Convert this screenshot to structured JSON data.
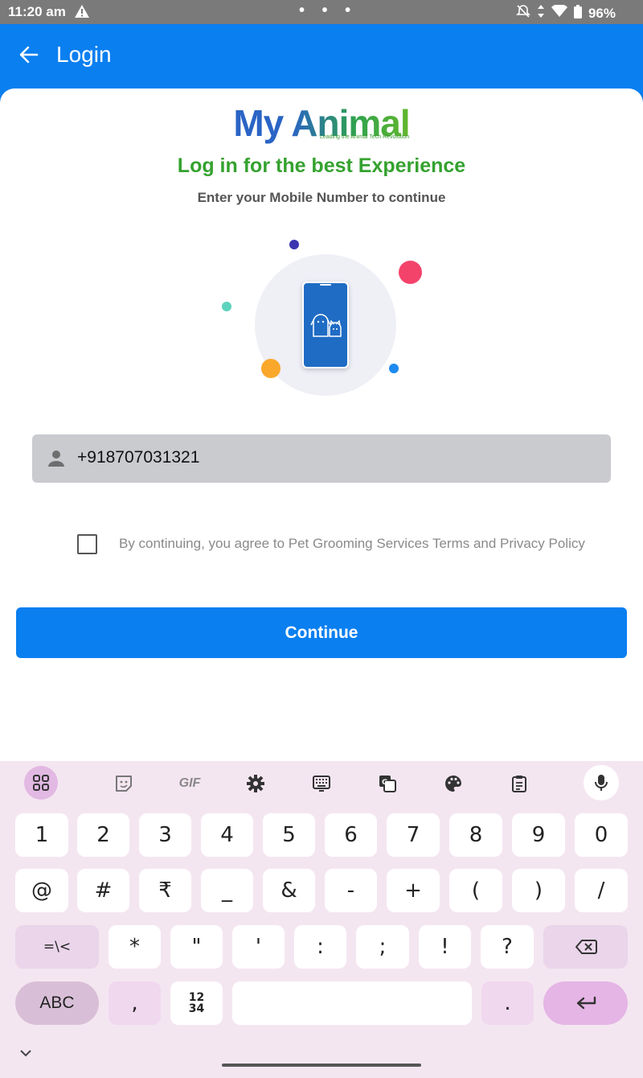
{
  "status_bar": {
    "time": "11:20 am",
    "battery": "96%",
    "dots": "• • •"
  },
  "app_bar": {
    "title": "Login"
  },
  "logo": {
    "word1": "My",
    "word2": "Animal",
    "tagline": "Leading the Animal Tech Revolution"
  },
  "headline": "Log in for the best Experience",
  "subline": "Enter your Mobile Number to continue",
  "phone_input": {
    "value": "+918707031321"
  },
  "consent": {
    "checked": false,
    "text": "By continuing, you agree to Pet Grooming Services Terms and Privacy Policy"
  },
  "continue_button": {
    "label": "Continue"
  },
  "colors": {
    "primary": "#0a7ff0",
    "headline_green": "#35a22f",
    "logo_blue": "#2a64c5",
    "dot_navy": "#3b35b0",
    "dot_red": "#f4436b",
    "dot_teal": "#5dd3bd",
    "dot_orange": "#f9a82c",
    "dot_blue": "#1e8af0"
  },
  "keyboard": {
    "toolbar_icons": [
      "apps-icon",
      "sticker-icon",
      "gif-icon",
      "settings-icon",
      "keyboard-icon",
      "translate-icon",
      "palette-icon",
      "clipboard-icon",
      "mic-icon"
    ],
    "gif_label": "GIF",
    "row1": [
      "1",
      "2",
      "3",
      "4",
      "5",
      "6",
      "7",
      "8",
      "9",
      "0"
    ],
    "row2": [
      "@",
      "#",
      "₹",
      "_",
      "&",
      "-",
      "+",
      "(",
      ")",
      "/"
    ],
    "row3_mod": "=\\<",
    "row3": [
      "*",
      "\"",
      "'",
      ":",
      ";",
      "!",
      "?"
    ],
    "abc": "ABC",
    "comma": ",",
    "numpad_label": "12\n34",
    "period": "."
  }
}
